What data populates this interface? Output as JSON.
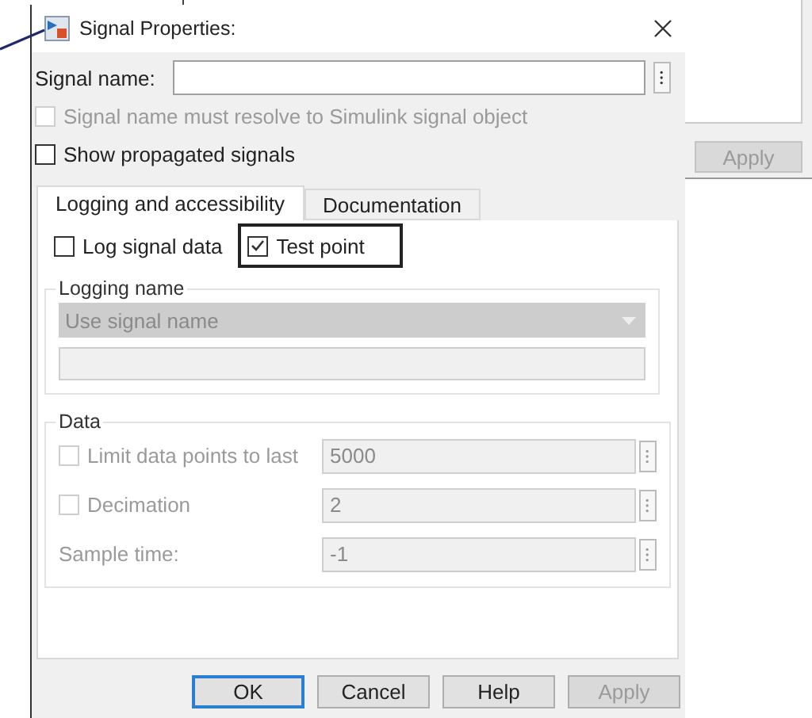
{
  "window": {
    "title": "Signal Properties:"
  },
  "signal_name": {
    "label": "Signal name:"
  },
  "options": [
    {
      "label": "Signal name must resolve to Simulink signal object",
      "checked": false,
      "disabled": true
    },
    {
      "label": "Show propagated signals",
      "checked": false,
      "disabled": false
    }
  ],
  "tabs": [
    {
      "label": "Logging and accessibility",
      "selected": true
    },
    {
      "label": "Documentation",
      "selected": false
    }
  ],
  "log_options": [
    {
      "label": "Log signal data",
      "checked": false,
      "highlighted": false
    },
    {
      "label": "Test point",
      "checked": true,
      "highlighted": true
    }
  ],
  "logging_name": {
    "title": "Logging name",
    "dropdown": "Use signal name",
    "disabled": true
  },
  "data": {
    "title": "Data",
    "rows": [
      {
        "kind": "checkbox",
        "label": "Limit data points to last",
        "checked": false,
        "value": "5000"
      },
      {
        "kind": "checkbox",
        "label": "Decimation",
        "checked": false,
        "value": "2"
      },
      {
        "kind": "label",
        "label": "Sample time:",
        "value": "-1"
      }
    ]
  },
  "buttons": [
    {
      "label": "OK",
      "default": true,
      "disabled": false
    },
    {
      "label": "Cancel",
      "default": false,
      "disabled": false
    },
    {
      "label": "Help",
      "default": false,
      "disabled": false
    },
    {
      "label": "Apply",
      "default": false,
      "disabled": true
    }
  ],
  "background_window": {
    "button": "Apply",
    "disabled": true
  }
}
